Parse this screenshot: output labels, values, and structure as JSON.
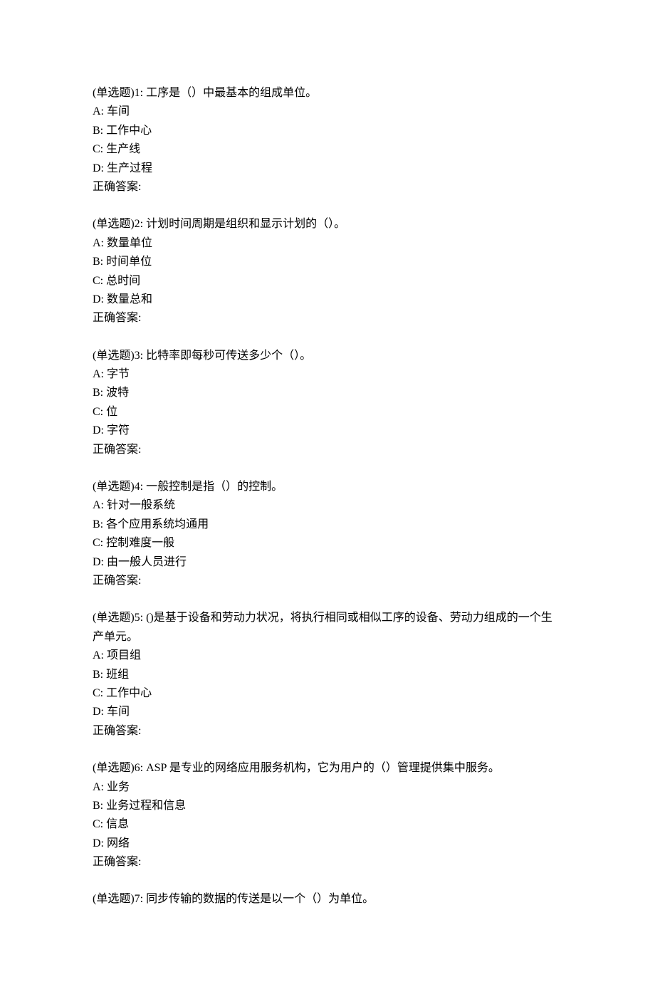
{
  "questions": [
    {
      "stem": "(单选题)1: 工序是（）中最基本的组成单位。",
      "options": [
        "A: 车间",
        "B: 工作中心",
        "C: 生产线",
        "D: 生产过程"
      ],
      "answer_label": "正确答案:"
    },
    {
      "stem": "(单选题)2: 计划时间周期是组织和显示计划的（）。",
      "options": [
        "A: 数量单位",
        "B: 时间单位",
        "C: 总时间",
        "D: 数量总和"
      ],
      "answer_label": "正确答案:"
    },
    {
      "stem": "(单选题)3: 比特率即每秒可传送多少个（）。",
      "options": [
        "A: 字节",
        "B: 波特",
        "C: 位",
        "D: 字符"
      ],
      "answer_label": "正确答案:"
    },
    {
      "stem": "(单选题)4: 一般控制是指（）的控制。",
      "options": [
        "A: 针对一般系统",
        "B: 各个应用系统均通用",
        "C: 控制难度一般",
        "D: 由一般人员进行"
      ],
      "answer_label": "正确答案:"
    },
    {
      "stem": "(单选题)5: ()是基于设备和劳动力状况，将执行相同或相似工序的设备、劳动力组成的一个生产单元。",
      "options": [
        "A: 项目组",
        "B: 班组",
        "C: 工作中心",
        "D: 车间"
      ],
      "answer_label": "正确答案:"
    },
    {
      "stem": "(单选题)6: ASP 是专业的网络应用服务机构，它为用户的（）管理提供集中服务。",
      "options": [
        "A: 业务",
        "B: 业务过程和信息",
        "C: 信息",
        "D: 网络"
      ],
      "answer_label": "正确答案:"
    },
    {
      "stem": "(单选题)7: 同步传输的数据的传送是以一个（）为单位。",
      "options": [],
      "answer_label": ""
    }
  ]
}
